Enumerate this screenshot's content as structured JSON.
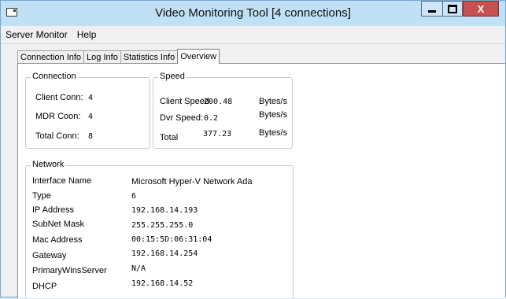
{
  "window": {
    "title": "Video Monitoring Tool [4 connections]",
    "close_glyph": "X"
  },
  "menu": [
    "Server Monitor",
    "Help"
  ],
  "tabs": [
    "Connection Info",
    "Log Info",
    "Statistics Info",
    "Overview"
  ],
  "active_tab": "Overview",
  "connection": {
    "legend": "Connection",
    "rows": [
      {
        "label": "Client Conn:",
        "value": "4"
      },
      {
        "label": "MDR Coon:",
        "value": "4"
      },
      {
        "label": "Total Conn:",
        "value": "8"
      }
    ]
  },
  "speed": {
    "legend": "Speed",
    "rows": [
      {
        "label": "Client Speed",
        "value": "200.48",
        "unit": "Bytes/s"
      },
      {
        "label": "Dvr Speed:",
        "value": "0.2",
        "unit": "Bytes/s"
      },
      {
        "label": "Total",
        "value": "377.23",
        "unit": "Bytes/s"
      }
    ]
  },
  "network": {
    "legend": "Network",
    "rows": [
      {
        "label": "Interface Name",
        "value": "Microsoft Hyper-V Network Ada"
      },
      {
        "label": "Type",
        "value": "6"
      },
      {
        "label": "IP Address",
        "value": "192.168.14.193"
      },
      {
        "label": "SubNet Mask",
        "value": "255.255.255.0"
      },
      {
        "label": "Mac Address",
        "value": "00:15:5D:06:31:04"
      },
      {
        "label": "Gateway",
        "value": "192.168.14.254"
      },
      {
        "label": "PrimaryWinsServer",
        "value": "N/A"
      },
      {
        "label": "DHCP",
        "value": "192.168.14.52"
      }
    ]
  }
}
